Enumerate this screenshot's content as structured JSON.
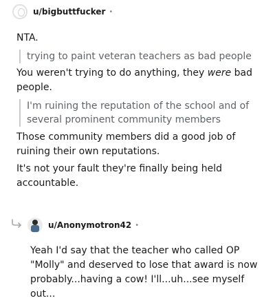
{
  "comment1": {
    "username": "u/bigbuttfucker",
    "separator": "•",
    "paragraph1": "NTA.",
    "quote1": "trying to paint veteran teachers as bad people",
    "paragraph2_before": "You weren't trying to do anything, they ",
    "paragraph2_em": "were",
    "paragraph2_after": " bad people.",
    "quote2": "I'm ruining the reputation of the school and of several prominent community members",
    "paragraph3": "Those community members did a good job of ruining their own reputations.",
    "paragraph4": "It's not your fault they're finally being held accountable.",
    "avatar_icon": "default-snoo-avatar-icon"
  },
  "comment2": {
    "username": "u/Anonymotron42",
    "separator": "•",
    "body": "Yeah I'd say that the teacher who called OP \"Molly\" and deserved to lose that award is now probably...having a cow! I'll...uh...see myself out...",
    "avatar_icon": "custom-snoo-avatar-icon",
    "reply_icon": "reply-arrow-icon"
  }
}
